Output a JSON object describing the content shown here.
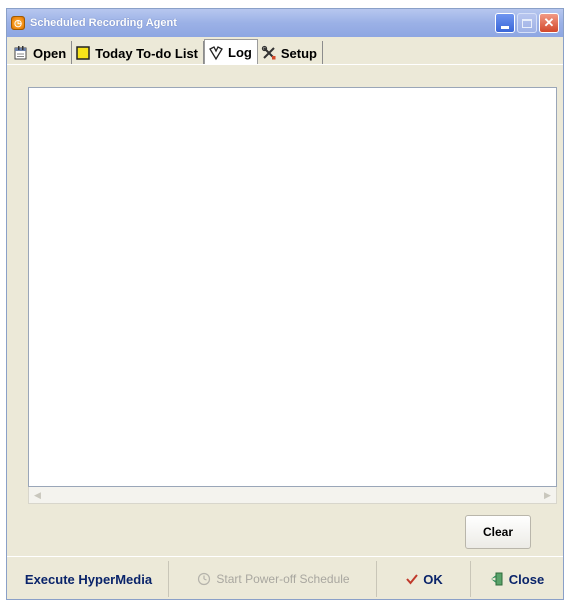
{
  "window": {
    "title": "Scheduled Recording Agent",
    "icon": "clock-icon"
  },
  "tabs": [
    {
      "label": "Open",
      "icon": "calendar-icon",
      "active": false
    },
    {
      "label": "Today To-do List",
      "icon": "sticky-note-icon",
      "active": false
    },
    {
      "label": "Log",
      "icon": "log-icon",
      "active": true
    },
    {
      "label": "Setup",
      "icon": "tools-icon",
      "active": false
    }
  ],
  "log": {
    "content": ""
  },
  "buttons": {
    "clear": "Clear",
    "execute": "Execute HyperMedia",
    "poweroff": "Start Power-off Schedule",
    "ok": "OK",
    "close": "Close"
  },
  "colors": {
    "titlebar": "#9bb1e6",
    "window_bg": "#ece9d8",
    "button_text": "#0a246a",
    "ok_check": "#c0392b",
    "close_icon": "#2e8b57"
  }
}
